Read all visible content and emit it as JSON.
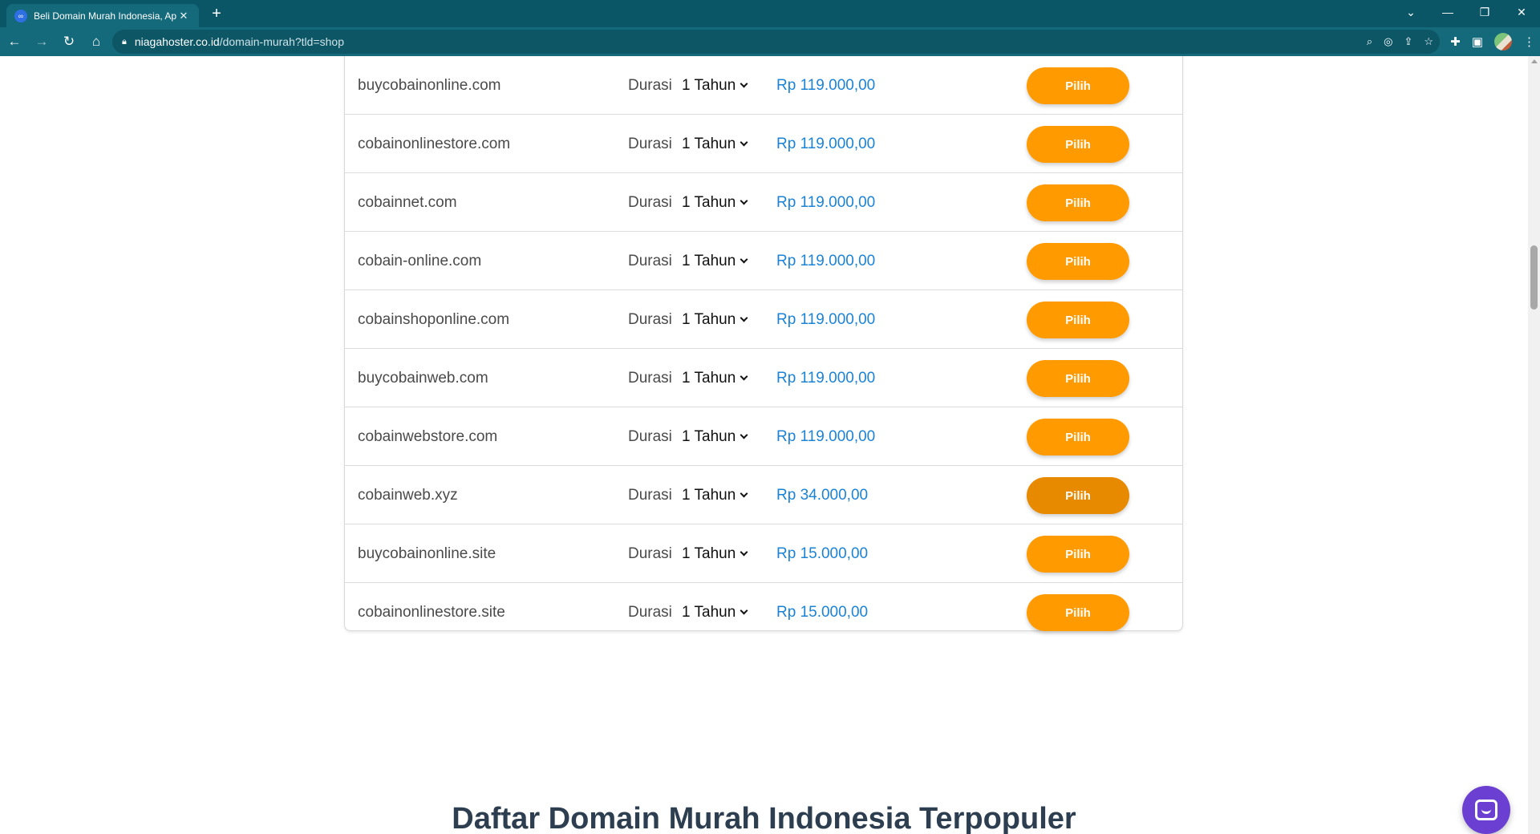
{
  "browser": {
    "tab_title": "Beli Domain Murah Indonesia, Ap",
    "tab_close": "✕",
    "new_tab": "+",
    "url_host": "niagahoster.co.id",
    "url_path": "/domain-murah?tld=shop",
    "window_controls": [
      "⌄",
      "—",
      "❐",
      "✕"
    ]
  },
  "domains": {
    "durasi_label": "Durasi",
    "rows": [
      {
        "name": "buycobainonline.com",
        "duration": "1 Tahun",
        "price": "Rp 119.000,00",
        "button": "Pilih"
      },
      {
        "name": "cobainonlinestore.com",
        "duration": "1 Tahun",
        "price": "Rp 119.000,00",
        "button": "Pilih"
      },
      {
        "name": "cobainnet.com",
        "duration": "1 Tahun",
        "price": "Rp 119.000,00",
        "button": "Pilih"
      },
      {
        "name": "cobain-online.com",
        "duration": "1 Tahun",
        "price": "Rp 119.000,00",
        "button": "Pilih"
      },
      {
        "name": "cobainshoponline.com",
        "duration": "1 Tahun",
        "price": "Rp 119.000,00",
        "button": "Pilih"
      },
      {
        "name": "buycobainweb.com",
        "duration": "1 Tahun",
        "price": "Rp 119.000,00",
        "button": "Pilih"
      },
      {
        "name": "cobainwebstore.com",
        "duration": "1 Tahun",
        "price": "Rp 119.000,00",
        "button": "Pilih"
      },
      {
        "name": "cobainweb.xyz",
        "duration": "1 Tahun",
        "price": "Rp 34.000,00",
        "button": "Pilih"
      },
      {
        "name": "buycobainonline.site",
        "duration": "1 Tahun",
        "price": "Rp 15.000,00",
        "button": "Pilih"
      },
      {
        "name": "cobainonlinestore.site",
        "duration": "1 Tahun",
        "price": "Rp 15.000,00",
        "button": "Pilih"
      }
    ]
  },
  "section": {
    "title": "Daftar Domain Murah Indonesia Terpopuler"
  },
  "colors": {
    "accent": "#ff9a00",
    "price": "#1b83d6",
    "chat": "#6a3fd2",
    "chrome": "#14697a"
  }
}
